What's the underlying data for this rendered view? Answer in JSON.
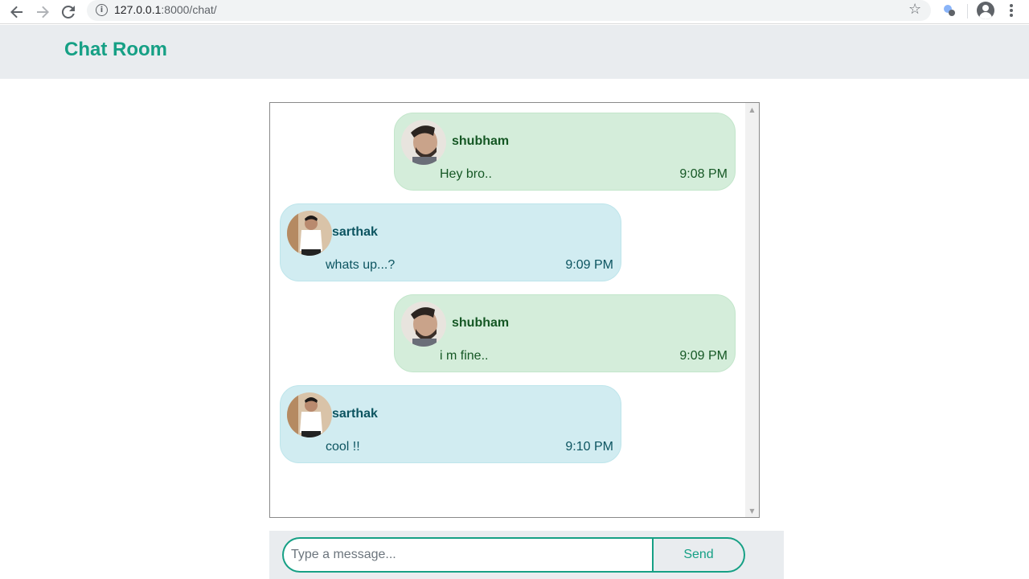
{
  "browser": {
    "url_host": "127.0.0.1",
    "url_rest": ":8000/chat/",
    "icons": [
      "back-arrow-icon",
      "forward-arrow-icon",
      "reload-icon",
      "info-icon",
      "star-icon",
      "extension-icon",
      "account-icon",
      "menu-icon"
    ]
  },
  "header": {
    "title": "Chat Room",
    "accent_color": "#16a085"
  },
  "messages": [
    {
      "user": "shubham",
      "text": "Hey bro..",
      "time": "9:08 PM",
      "direction": "sent"
    },
    {
      "user": "sarthak",
      "text": "whats up...?",
      "time": "9:09 PM",
      "direction": "received"
    },
    {
      "user": "shubham",
      "text": "i m fine..",
      "time": "9:09 PM",
      "direction": "sent"
    },
    {
      "user": "sarthak",
      "text": "cool !!",
      "time": "9:10 PM",
      "direction": "received"
    }
  ],
  "composer": {
    "placeholder": "Type a message...",
    "value": "",
    "send_label": "Send"
  }
}
